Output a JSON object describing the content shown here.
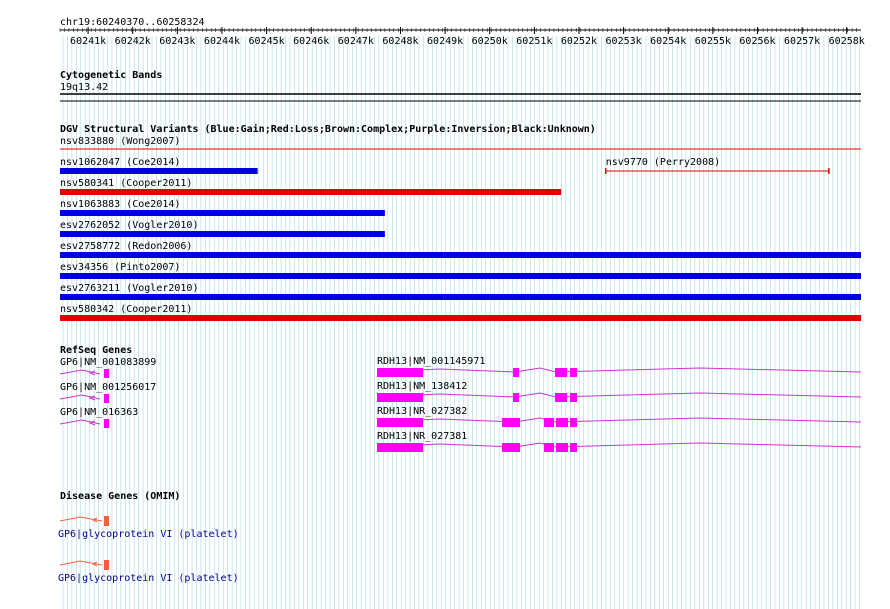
{
  "ruler": {
    "location": "chr19:60240370..60258324",
    "ticks": [
      "60241k",
      "60242k",
      "60243k",
      "60244k",
      "60245k",
      "60246k",
      "60247k",
      "60248k",
      "60249k",
      "60250k",
      "60251k",
      "60252k",
      "60253k",
      "60254k",
      "60255k",
      "60256k",
      "60257k",
      "60258k"
    ]
  },
  "tracks": {
    "cytoband": {
      "title": "Cytogenetic Bands",
      "band": "19q13.42"
    },
    "dgv": {
      "title": "DGV Structural Variants (Blue:Gain;Red:Loss;Brown:Complex;Purple:Inversion;Black:Unknown)",
      "features": [
        {
          "label": "nsv833880 (Wong2007)",
          "type": "loss",
          "start_kb": 60240.37,
          "end_kb": 60258.32,
          "style": "thin"
        },
        {
          "label": "nsv1062047 (Coe2014)",
          "type": "gain",
          "start_kb": 60240.37,
          "end_kb": 60244.8,
          "style": "thick"
        },
        {
          "label": "nsv9770 (Perry2008)",
          "type": "loss",
          "start_kb": 60252.6,
          "end_kb": 60257.6,
          "style": "whisker"
        },
        {
          "label": "nsv580341 (Cooper2011)",
          "type": "loss",
          "start_kb": 60240.37,
          "end_kb": 60251.6,
          "style": "thick"
        },
        {
          "label": "nsv1063883 (Coe2014)",
          "type": "gain",
          "start_kb": 60240.37,
          "end_kb": 60247.65,
          "style": "thick"
        },
        {
          "label": "esv2762052 (Vogler2010)",
          "type": "gain",
          "start_kb": 60240.37,
          "end_kb": 60247.65,
          "style": "thick"
        },
        {
          "label": "esv2758772 (Redon2006)",
          "type": "gain",
          "start_kb": 60240.37,
          "end_kb": 60258.32,
          "style": "thick"
        },
        {
          "label": "esv34356 (Pinto2007)",
          "type": "gain",
          "start_kb": 60240.37,
          "end_kb": 60258.32,
          "style": "thick"
        },
        {
          "label": "esv2763211 (Vogler2010)",
          "type": "gain",
          "start_kb": 60240.37,
          "end_kb": 60258.32,
          "style": "thick"
        },
        {
          "label": "nsv580342 (Cooper2011)",
          "type": "loss",
          "start_kb": 60240.37,
          "end_kb": 60258.32,
          "style": "thick"
        }
      ]
    },
    "refseq": {
      "title": "RefSeq Genes",
      "gp6": [
        "GP6|NM_001083899",
        "GP6|NM_001256017",
        "GP6|NM_016363"
      ],
      "rdh13": [
        "RDH13|NM_001145971",
        "RDH13|NM_138412",
        "RDH13|NR_027382",
        "RDH13|NR_027381"
      ]
    },
    "omim": {
      "title": "Disease Genes (OMIM)",
      "features": [
        "GP6|glycoprotein VI (platelet)",
        "GP6|glycoprotein VI (platelet)"
      ]
    }
  },
  "colors": {
    "gain": "#0000e0",
    "loss": "#e00000",
    "refseq": "#ff00ff",
    "refseq_line": "#cc33cc",
    "omim": "#f06040",
    "omim_text": "#00008b",
    "grid": "#a8d8e0",
    "border": "#000000"
  }
}
